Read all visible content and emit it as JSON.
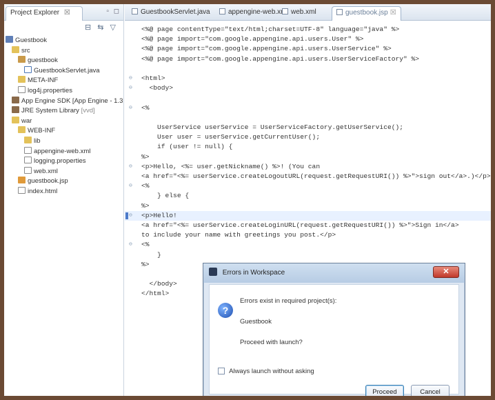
{
  "explorer": {
    "tab_label": "Project Explorer",
    "tab_close": "☒",
    "view_buttons": "▫ ◻",
    "toolbar_icons": "⊟ ⇆ ▽",
    "tree": [
      {
        "label": "Guestbook",
        "icon": "project-icon",
        "indent": 0
      },
      {
        "label": "src",
        "icon": "folder-icon",
        "indent": 1
      },
      {
        "label": "guestbook",
        "icon": "package-icon",
        "indent": 2
      },
      {
        "label": "GuestbookServlet.java",
        "icon": "java-file-icon",
        "indent": 3
      },
      {
        "label": "META-INF",
        "icon": "folder-icon",
        "indent": 2
      },
      {
        "label": "log4j.properties",
        "icon": "file-icon",
        "indent": 2
      },
      {
        "label": "App Engine SDK [App Engine - 1.3.",
        "icon": "library-icon",
        "indent": 1
      },
      {
        "label": "JRE System Library",
        "suffix": " [vvd]",
        "icon": "library-icon",
        "indent": 1
      },
      {
        "label": "war",
        "icon": "folder-icon",
        "indent": 1
      },
      {
        "label": "WEB-INF",
        "icon": "folder-icon",
        "indent": 2
      },
      {
        "label": "lib",
        "icon": "folder-icon",
        "indent": 3
      },
      {
        "label": "appengine-web.xml",
        "icon": "file-icon",
        "indent": 3
      },
      {
        "label": "logging.properties",
        "icon": "file-icon",
        "indent": 3
      },
      {
        "label": "web.xml",
        "icon": "file-icon",
        "indent": 3
      },
      {
        "label": "guestbook.jsp",
        "icon": "jsp-file-icon",
        "indent": 2
      },
      {
        "label": "index.html",
        "icon": "file-icon",
        "indent": 2
      }
    ]
  },
  "editor": {
    "tabs": [
      {
        "label": "GuestbookServlet.java",
        "active": false
      },
      {
        "label": "appengine-web.xml",
        "active": false
      },
      {
        "label": "web.xml",
        "active": false
      },
      {
        "label": "guestbook.jsp",
        "active": true
      }
    ],
    "active_tab_close": "☒",
    "lines": [
      {
        "text": "<%@ page contentType=\"text/html;charset=UTF-8\" language=\"java\" %>",
        "fold": ""
      },
      {
        "text": "<%@ page import=\"com.google.appengine.api.users.User\" %>",
        "fold": ""
      },
      {
        "text": "<%@ page import=\"com.google.appengine.api.users.UserService\" %>",
        "fold": ""
      },
      {
        "text": "<%@ page import=\"com.google.appengine.api.users.UserServiceFactory\" %>",
        "fold": ""
      },
      {
        "text": "",
        "fold": ""
      },
      {
        "text": "<html>",
        "fold": "⊖"
      },
      {
        "text": "  <body>",
        "fold": "⊖"
      },
      {
        "text": "",
        "fold": ""
      },
      {
        "text": "<%",
        "fold": "⊖"
      },
      {
        "text": "",
        "fold": ""
      },
      {
        "text": "    UserService userService = UserServiceFactory.getUserService();",
        "fold": ""
      },
      {
        "text": "    User user = userService.getCurrentUser();",
        "fold": ""
      },
      {
        "text": "    if (user != null) {",
        "fold": ""
      },
      {
        "text": "%>",
        "fold": ""
      },
      {
        "text": "<p>Hello, <%= user.getNickname() %>! (You can",
        "fold": "⊖"
      },
      {
        "text": "<a href=\"<%= userService.createLogoutURL(request.getRequestURI()) %>\">sign out</a>.)</p>",
        "fold": ""
      },
      {
        "text": "<%",
        "fold": "⊖"
      },
      {
        "text": "    } else {",
        "fold": ""
      },
      {
        "text": "%>",
        "fold": ""
      },
      {
        "text": "<p>Hello!",
        "fold": "⊖",
        "highlight": true
      },
      {
        "text": "<a href=\"<%= userService.createLoginURL(request.getRequestURI()) %>\">Sign in</a>",
        "fold": ""
      },
      {
        "text": "to include your name with greetings you post.</p>",
        "fold": ""
      },
      {
        "text": "<%",
        "fold": "⊖"
      },
      {
        "text": "    }",
        "fold": ""
      },
      {
        "text": "%>",
        "fold": ""
      },
      {
        "text": "",
        "fold": ""
      },
      {
        "text": "  </body>",
        "fold": ""
      },
      {
        "text": "</html>",
        "fold": ""
      }
    ]
  },
  "dialog": {
    "title": "Errors in Workspace",
    "close_label": "✕",
    "question_glyph": "?",
    "message": "Errors exist in required project(s):",
    "project": "Guestbook",
    "prompt": "Proceed with launch?",
    "checkbox_label": "Always launch without asking",
    "proceed_label": "Proceed",
    "cancel_label": "Cancel"
  },
  "colors": {
    "border_frame": "#6b4a34",
    "selection_blue": "#e8f1ff",
    "dialog_close_red": "#c0392b"
  }
}
